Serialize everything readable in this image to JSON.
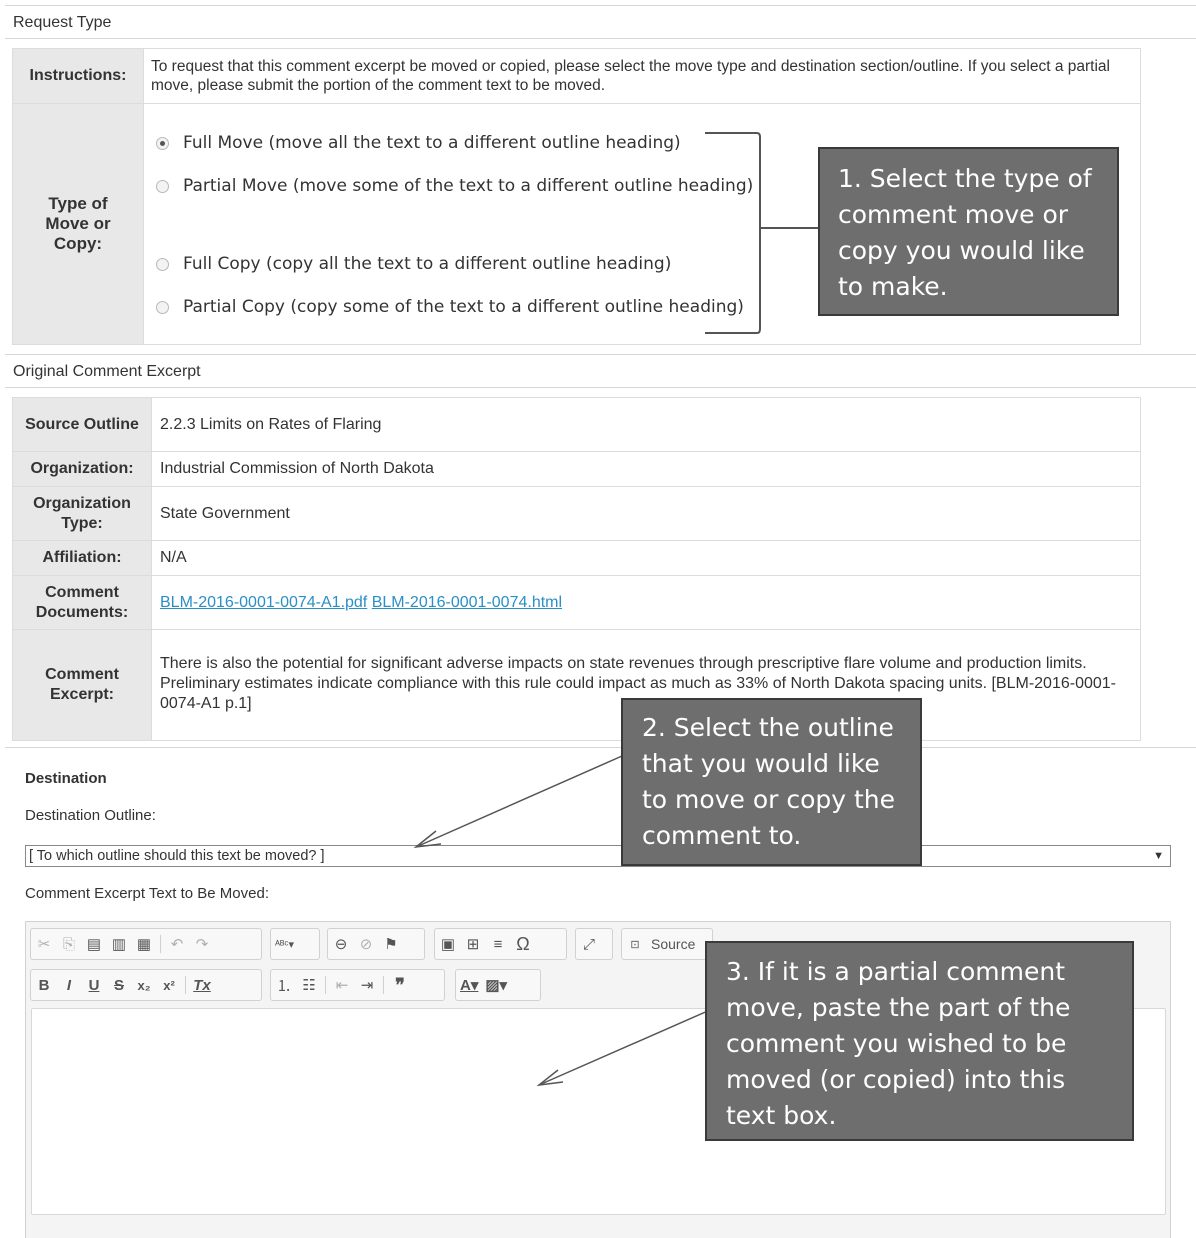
{
  "request_type": {
    "heading": "Request Type",
    "instructions_label": "Instructions:",
    "instructions_text": "To request that this comment excerpt be moved or copied, please select the move type and destination section/outline. If you select a partial move, please submit the portion of the comment text to be moved.",
    "type_label": "Type of Move or Copy:",
    "options": [
      {
        "label": "Full Move (move all the text to a different outline heading)",
        "selected": true
      },
      {
        "label": "Partial Move (move some of the text to a different outline heading)",
        "selected": false
      },
      {
        "label": "Full Copy (copy all the text to a different outline heading)",
        "selected": false
      },
      {
        "label": "Partial Copy (copy some of the text to a different outline heading)",
        "selected": false
      }
    ]
  },
  "original_comment": {
    "heading": "Original Comment Excerpt",
    "rows": [
      {
        "label": "Source Outline",
        "value": "2.2.3 Limits on Rates of Flaring"
      },
      {
        "label": "Organization:",
        "value": "Industrial Commission of North Dakota"
      },
      {
        "label": "Organization Type:",
        "value": "State Government"
      },
      {
        "label": "Affiliation:",
        "value": "N/A"
      },
      {
        "label": "Comment Documents:",
        "links": [
          "BLM-2016-0001-0074-A1.pdf",
          "BLM-2016-0001-0074.html"
        ]
      },
      {
        "label": "Comment Excerpt:",
        "value": "There is also the potential for significant adverse impacts on state revenues through prescriptive flare volume and production limits. Preliminary estimates indicate compliance with this rule could impact as much as 33% of North Dakota spacing units. [BLM-2016-0001-0074-A1 p.1]"
      }
    ]
  },
  "destination": {
    "heading": "Destination",
    "outline_label": "Destination Outline:",
    "outline_selected": "[ To which outline should this text be moved? ]",
    "excerpt_label": "Comment Excerpt Text to Be Moved:",
    "source_button": "Source"
  },
  "callouts": {
    "c1": "1. Select the type of comment move or copy you would like to make.",
    "c2": "2. Select the outline that you would like to move or copy the comment to.",
    "c3": "3. If it is a partial comment move, paste the part of the comment you wished to be moved (or copied) into this text box."
  },
  "colors": {
    "label_bg": "#e8e8e8",
    "link": "#2a8fc6",
    "callout_bg": "#6e6e6e"
  }
}
